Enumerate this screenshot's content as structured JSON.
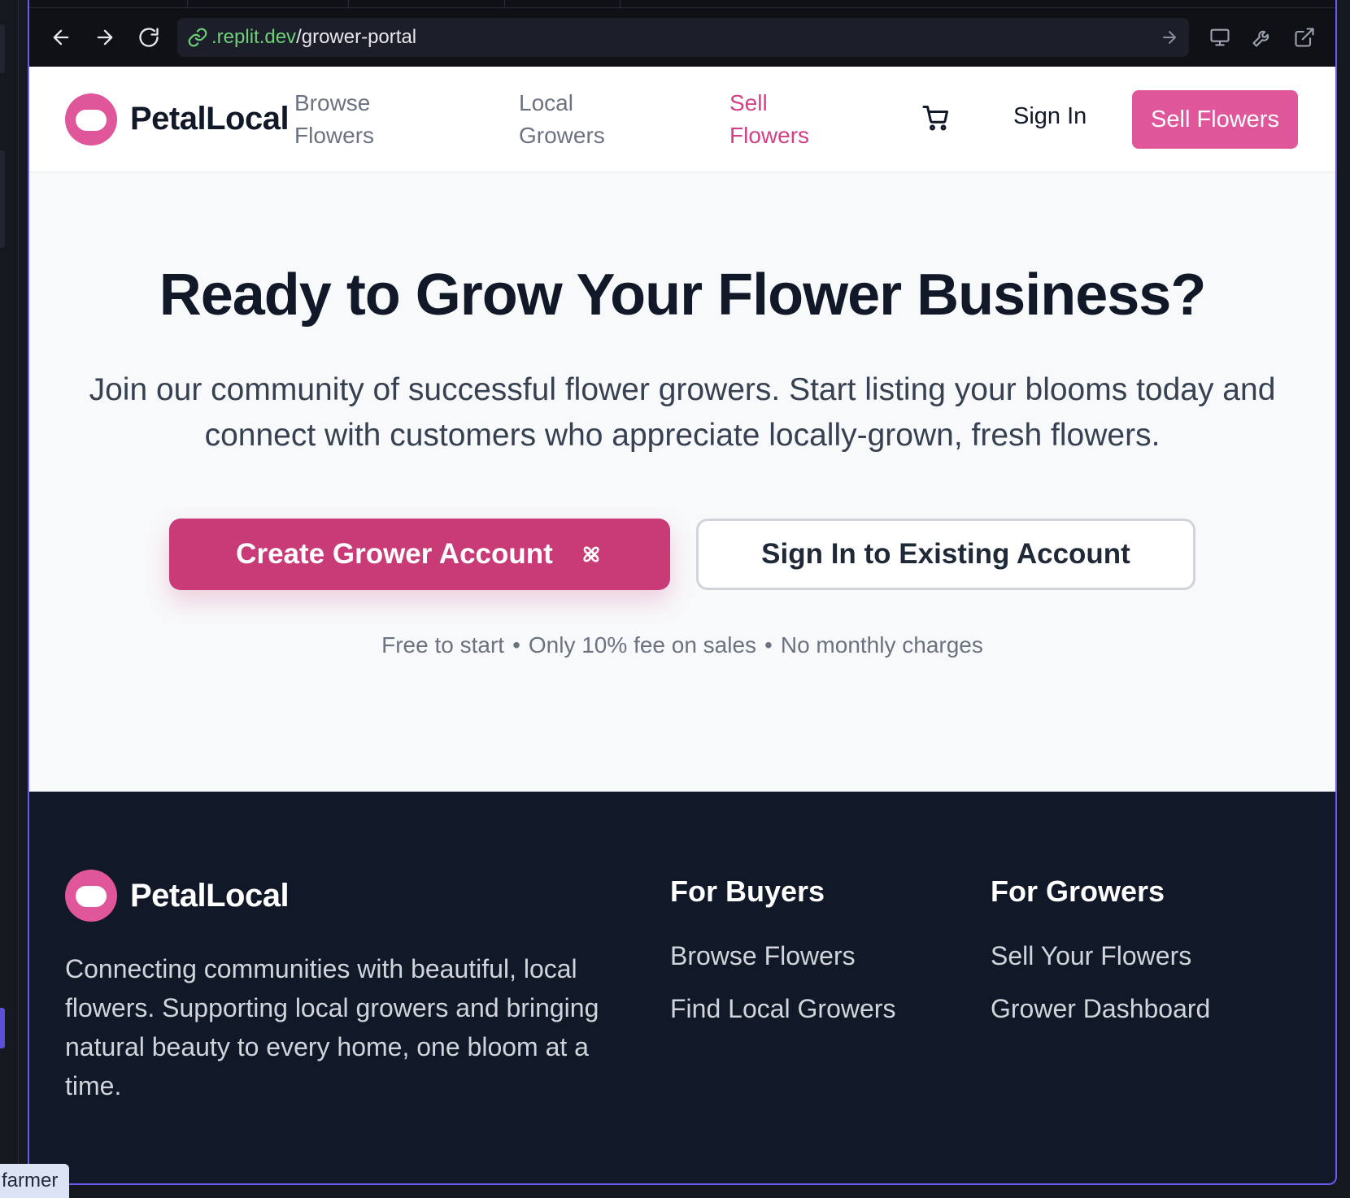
{
  "browser": {
    "url_domain": ".replit.dev",
    "url_path": "/grower-portal"
  },
  "header": {
    "brand": "PetalLocal",
    "nav": [
      {
        "label": "Browse\nFlowers"
      },
      {
        "label": "Local\nGrowers"
      },
      {
        "label": "Sell\nFlowers"
      }
    ],
    "sign_in": "Sign In",
    "sell_button": "Sell Flowers"
  },
  "hero": {
    "title": "Ready to Grow Your Flower Business?",
    "subtitle": "Join our community of successful flower growers. Start listing your blooms today and connect with customers who appreciate locally-grown, fresh flowers.",
    "primary_button": "Create Grower Account",
    "secondary_button": "Sign In to Existing Account",
    "terms": [
      "Free to start",
      "Only 10% fee on sales",
      "No monthly charges"
    ],
    "terms_separator": "•"
  },
  "footer": {
    "brand": "PetalLocal",
    "description": "Connecting communities with beautiful, local flowers. Supporting local growers and bringing natural beauty to every home, one bloom at a time.",
    "buyers": {
      "heading": "For Buyers",
      "links": [
        "Browse Flowers",
        "Find Local Growers"
      ]
    },
    "growers": {
      "heading": "For Growers",
      "links": [
        "Sell Your Flowers",
        "Grower Dashboard"
      ]
    }
  },
  "tooltip": "farmer",
  "colors": {
    "brand_pink": "#e0569a",
    "primary_button": "#c93b76",
    "active_nav": "#d43f86",
    "footer_bg": "#111827",
    "url_domain": "#6fcf7a"
  }
}
